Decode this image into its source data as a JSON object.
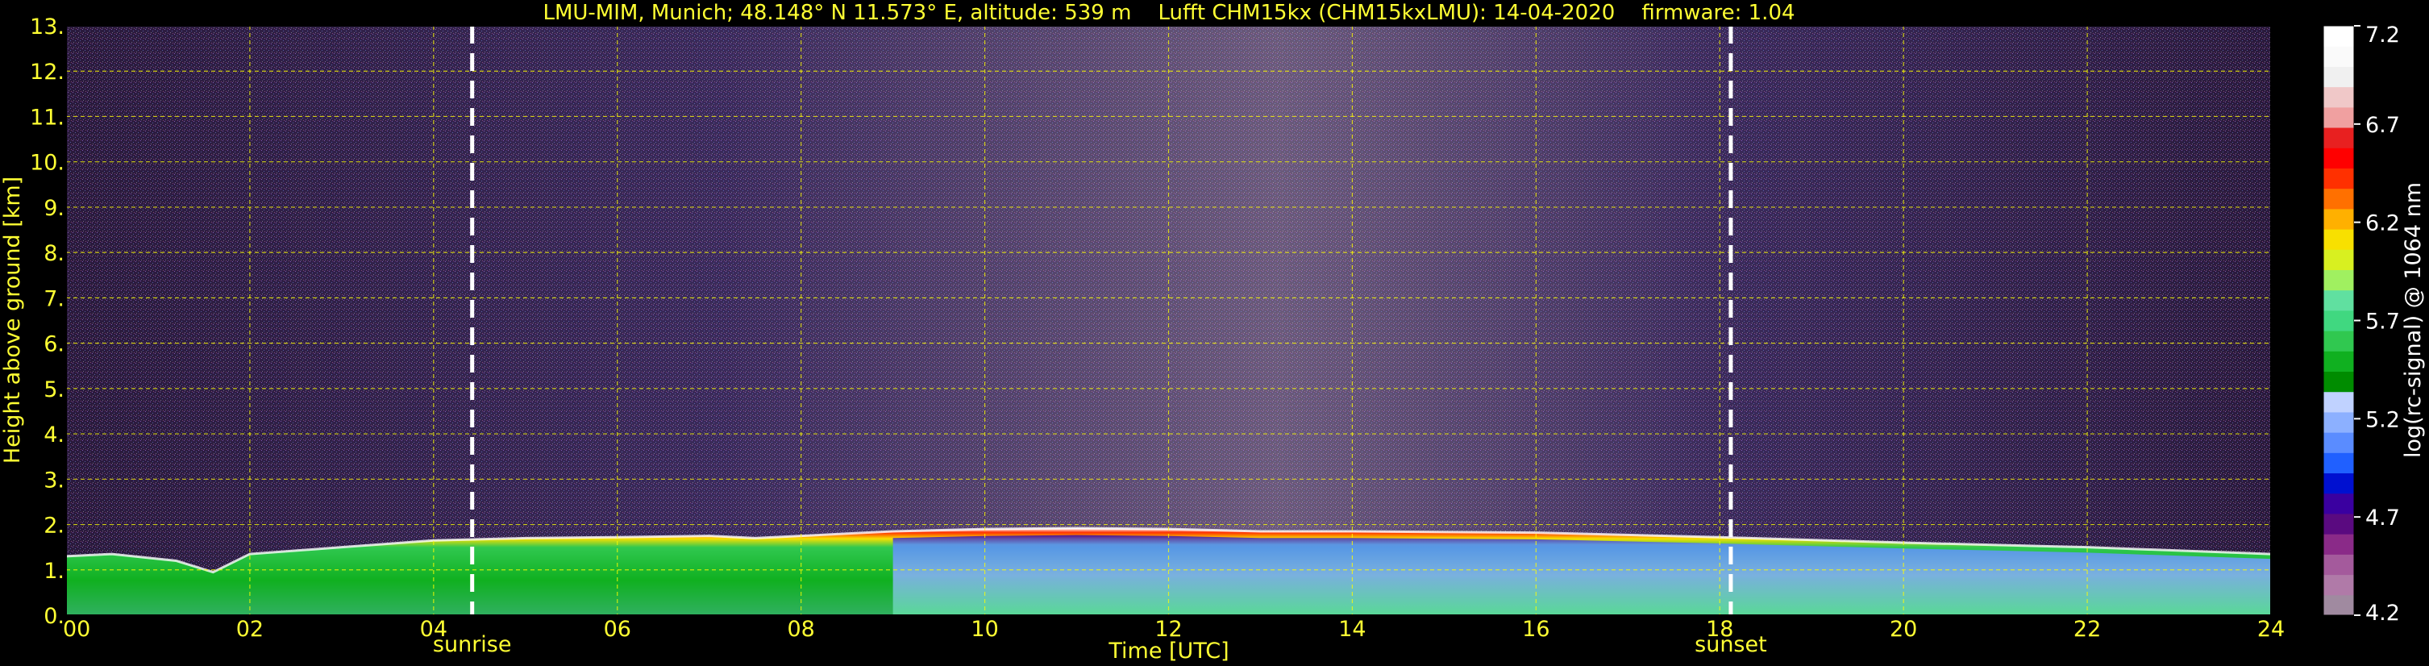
{
  "chart_data": {
    "type": "heatmap",
    "title": "LMU-MIM, Munich; 48.148° N 11.573° E, altitude: 539 m    Lufft CHM15kx (CHM15kxLMU): 14-04-2020    firmware: 1.04",
    "xlabel": "Time [UTC]",
    "ylabel": "Height above ground [km]",
    "xlim": [
      0,
      24
    ],
    "ylim": [
      0,
      13
    ],
    "x_ticks": [
      "00",
      "02",
      "04",
      "06",
      "08",
      "10",
      "12",
      "14",
      "16",
      "18",
      "20",
      "22",
      "24"
    ],
    "y_ticks": [
      "0.",
      "1.",
      "2.",
      "3.",
      "4.",
      "5.",
      "6.",
      "7.",
      "8.",
      "9.",
      "10.",
      "11.",
      "12.",
      "13."
    ],
    "grid": true,
    "grid_color": "#ffff00",
    "markers": [
      {
        "label": "sunrise",
        "x": 4.42
      },
      {
        "label": "sunset",
        "x": 18.12
      }
    ],
    "colorbar": {
      "label": "log(rc-signal) @ 1064 nm",
      "range": [
        4.2,
        7.2
      ],
      "ticks": [
        "4.2",
        "4.7",
        "5.2",
        "5.7",
        "6.2",
        "6.7",
        "7.2"
      ],
      "colors": [
        "#a08aa0",
        "#b07aa8",
        "#a45a9c",
        "#8a2a88",
        "#5a0a80",
        "#3a00a0",
        "#0010d0",
        "#2060ff",
        "#5a8cff",
        "#8cb0ff",
        "#c0d2ff",
        "#008c00",
        "#10b020",
        "#30c850",
        "#40d880",
        "#60e0a0",
        "#a0f060",
        "#d8f020",
        "#f8e000",
        "#ffb000",
        "#ff7000",
        "#ff3000",
        "#ff0000",
        "#e82020",
        "#f0a0a0",
        "#f0c8c8",
        "#f0f0f0",
        "#fafafa",
        "#ffffff"
      ]
    },
    "boundary_layer_top_km": [
      [
        0,
        1.3
      ],
      [
        0.5,
        1.35
      ],
      [
        1.2,
        1.2
      ],
      [
        1.6,
        0.95
      ],
      [
        2.0,
        1.35
      ],
      [
        3.0,
        1.5
      ],
      [
        4.0,
        1.65
      ],
      [
        5.0,
        1.7
      ],
      [
        6.0,
        1.72
      ],
      [
        7.0,
        1.75
      ],
      [
        7.5,
        1.7
      ],
      [
        8.0,
        1.75
      ],
      [
        9.0,
        1.85
      ],
      [
        10.0,
        1.9
      ],
      [
        11.0,
        1.92
      ],
      [
        12.0,
        1.9
      ],
      [
        13.0,
        1.85
      ],
      [
        14.0,
        1.85
      ],
      [
        16.0,
        1.82
      ],
      [
        18.0,
        1.72
      ],
      [
        20.0,
        1.6
      ],
      [
        22.0,
        1.5
      ],
      [
        24.0,
        1.35
      ]
    ]
  }
}
